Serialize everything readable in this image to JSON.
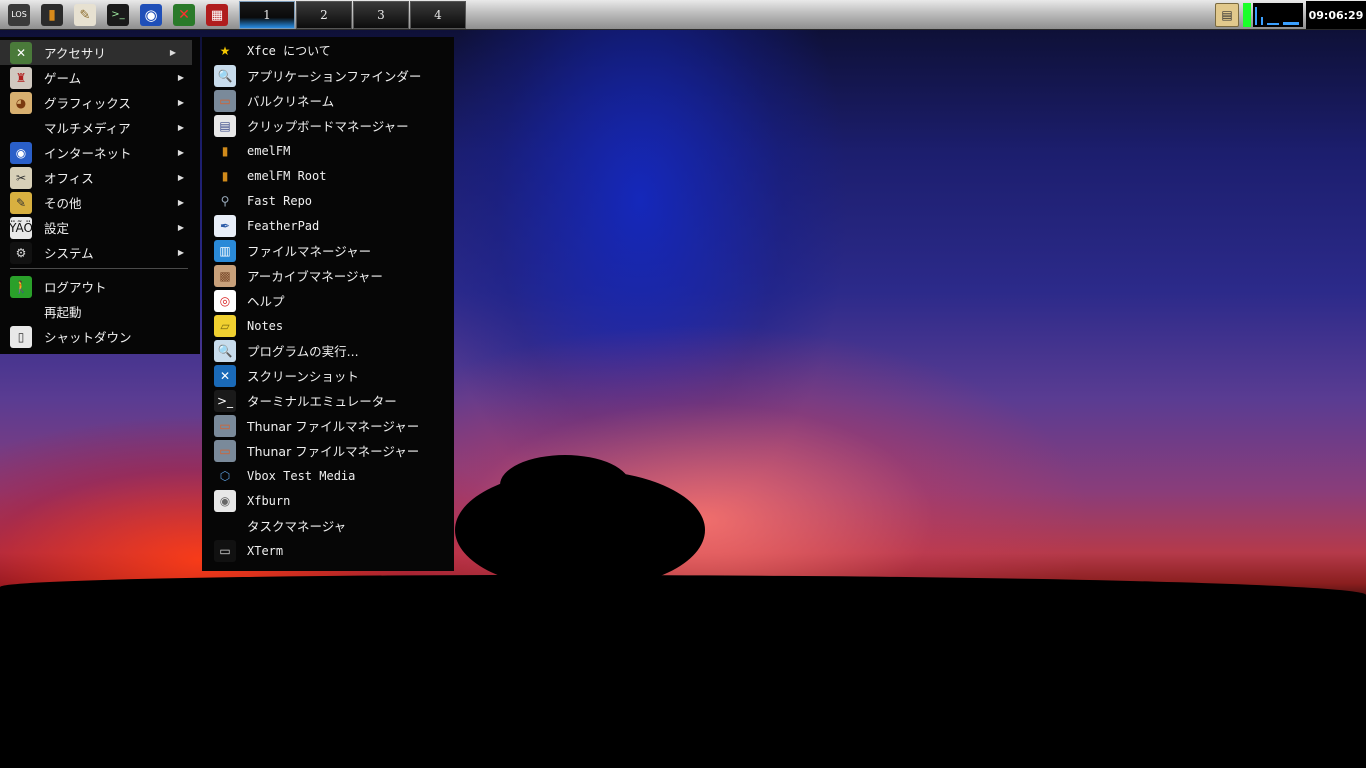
{
  "panel": {
    "launchers": [
      {
        "name": "app-menu-icon",
        "glyph": "LOS"
      },
      {
        "name": "file-manager-icon",
        "glyph": "▮"
      },
      {
        "name": "text-editor-icon",
        "glyph": "✎"
      },
      {
        "name": "terminal-icon",
        "glyph": ">_"
      },
      {
        "name": "web-browser-icon",
        "glyph": "◉"
      },
      {
        "name": "tools-icon",
        "glyph": "✕"
      },
      {
        "name": "software-installer-icon",
        "glyph": "▦"
      }
    ],
    "workspaces": [
      "1",
      "2",
      "3",
      "4"
    ],
    "active_workspace": 0,
    "clock": "09:06:29"
  },
  "main_menu": {
    "items": [
      {
        "label": "アクセサリ",
        "icon": "accessories-icon",
        "glyph": "✕",
        "submenu": true,
        "highlight": true
      },
      {
        "label": "ゲーム",
        "icon": "games-icon",
        "glyph": "♜",
        "submenu": true
      },
      {
        "label": "グラフィックス",
        "icon": "graphics-icon",
        "glyph": "◕",
        "submenu": true
      },
      {
        "label": "マルチメディア",
        "icon": "",
        "glyph": "",
        "submenu": true
      },
      {
        "label": "インターネット",
        "icon": "internet-icon",
        "glyph": "◉",
        "submenu": true
      },
      {
        "label": "オフィス",
        "icon": "office-icon",
        "glyph": "✂",
        "submenu": true
      },
      {
        "label": "その他",
        "icon": "other-icon",
        "glyph": "✎",
        "submenu": true
      },
      {
        "label": "設定",
        "icon": "settings-icon",
        "glyph": "ŸÃÖ",
        "submenu": true
      },
      {
        "label": "システム",
        "icon": "system-gear-icon",
        "glyph": "⚙",
        "submenu": true
      }
    ],
    "session_items": [
      {
        "label": "ログアウト",
        "icon": "logout-icon",
        "glyph": "🚶"
      },
      {
        "label": "再起動",
        "icon": "",
        "glyph": ""
      },
      {
        "label": "シャットダウン",
        "icon": "shutdown-icon",
        "glyph": "▯"
      }
    ]
  },
  "accessories_menu": {
    "items": [
      {
        "label": "Xfce について",
        "icon": "star-icon",
        "glyph": "★",
        "mono": true
      },
      {
        "label": "アプリケーションファインダー",
        "icon": "magnifier-icon",
        "glyph": "🔍"
      },
      {
        "label": "バルクリネーム",
        "icon": "bulk-rename-icon",
        "glyph": "▭"
      },
      {
        "label": "クリップボードマネージャー",
        "icon": "clipboard-icon",
        "glyph": "▤"
      },
      {
        "label": "emelFM",
        "icon": "emelfm-icon",
        "glyph": "▮",
        "mono": true
      },
      {
        "label": "emelFM Root",
        "icon": "emelfm-root-icon",
        "glyph": "▮",
        "mono": true
      },
      {
        "label": "Fast Repo",
        "icon": "search-icon",
        "glyph": "⚲",
        "mono": true
      },
      {
        "label": "FeatherPad",
        "icon": "feather-icon",
        "glyph": "✒",
        "mono": true
      },
      {
        "label": "ファイルマネージャー",
        "icon": "file-manager-icon",
        "glyph": "▥"
      },
      {
        "label": "アーカイブマネージャー",
        "icon": "archive-icon",
        "glyph": "▩"
      },
      {
        "label": "ヘルプ",
        "icon": "lifebuoy-help-icon",
        "glyph": "◎"
      },
      {
        "label": "Notes",
        "icon": "notes-icon",
        "glyph": "▱",
        "mono": true
      },
      {
        "label": "プログラムの実行...",
        "icon": "run-program-icon",
        "glyph": "🔍"
      },
      {
        "label": "スクリーンショット",
        "icon": "screenshot-icon",
        "glyph": "✕"
      },
      {
        "label": "ターミナルエミュレーター",
        "icon": "terminal-icon",
        "glyph": ">_"
      },
      {
        "label": "Thunar ファイルマネージャー",
        "icon": "thunar-icon",
        "glyph": "▭"
      },
      {
        "label": "Thunar ファイルマネージャー",
        "icon": "thunar-root-icon",
        "glyph": "▭"
      },
      {
        "label": "Vbox Test Media",
        "icon": "virtualbox-cube-icon",
        "glyph": "⬡",
        "mono": true
      },
      {
        "label": "Xfburn",
        "icon": "disc-burn-icon",
        "glyph": "◉",
        "mono": true
      },
      {
        "label": "タスクマネージャ",
        "icon": "",
        "glyph": ""
      },
      {
        "label": "XTerm",
        "icon": "xterm-icon",
        "glyph": "▭",
        "mono": true
      }
    ]
  },
  "colors": {
    "menu_bg": "#060606",
    "highlight": "#2e2e2e",
    "workspace_accent": "#2a8ce0"
  }
}
